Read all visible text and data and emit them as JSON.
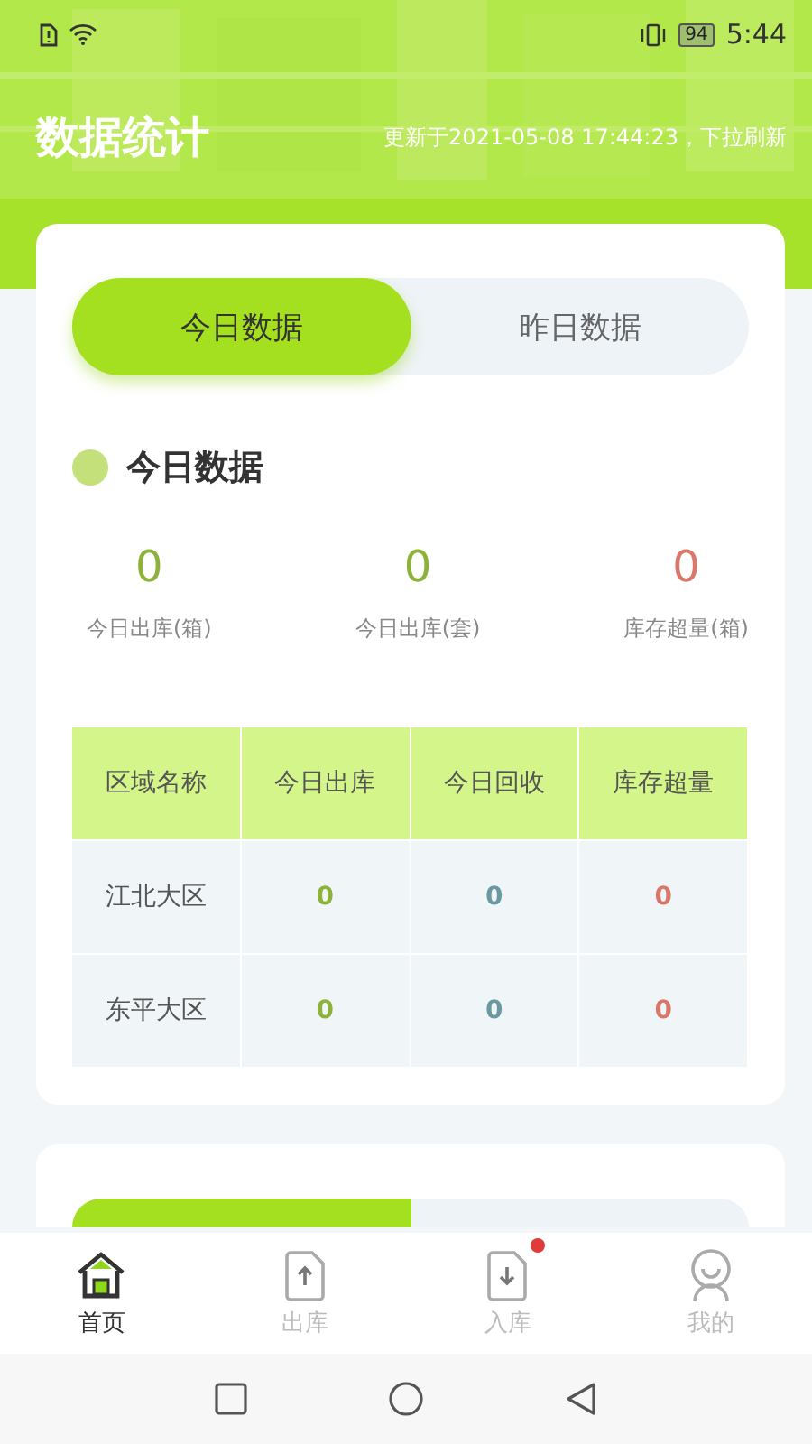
{
  "status_bar": {
    "battery": "94",
    "time": "5:44"
  },
  "header": {
    "title": "数据统计",
    "updated": "更新于2021-05-08 17:44:23，下拉刷新"
  },
  "card": {
    "tabs": [
      {
        "label": "今日数据",
        "selected": true
      },
      {
        "label": "昨日数据",
        "selected": false
      }
    ],
    "section_title": "今日数据",
    "stats": [
      {
        "value": "0",
        "label": "今日出库(箱)",
        "kind": "good"
      },
      {
        "value": "0",
        "label": "今日出库(套)",
        "kind": "good"
      },
      {
        "value": "0",
        "label": "库存超量(箱)",
        "kind": "warn"
      }
    ],
    "table": {
      "columns": [
        "区域名称",
        "今日出库",
        "今日回收",
        "库存超量"
      ],
      "rows": [
        [
          "江北大区",
          "0",
          "0",
          "0"
        ],
        [
          "东平大区",
          "0",
          "0",
          "0"
        ]
      ]
    }
  },
  "second_card": {
    "tabs": [
      {
        "selected": true
      },
      {
        "selected": false
      }
    ]
  },
  "tab_bar": [
    {
      "label": "首页",
      "kind": "home",
      "selected": true,
      "badge": false
    },
    {
      "label": "出库",
      "kind": "out",
      "selected": false,
      "badge": false
    },
    {
      "label": "入库",
      "kind": "in",
      "selected": false,
      "badge": true
    },
    {
      "label": "我的",
      "kind": "me",
      "selected": false,
      "badge": false
    }
  ]
}
